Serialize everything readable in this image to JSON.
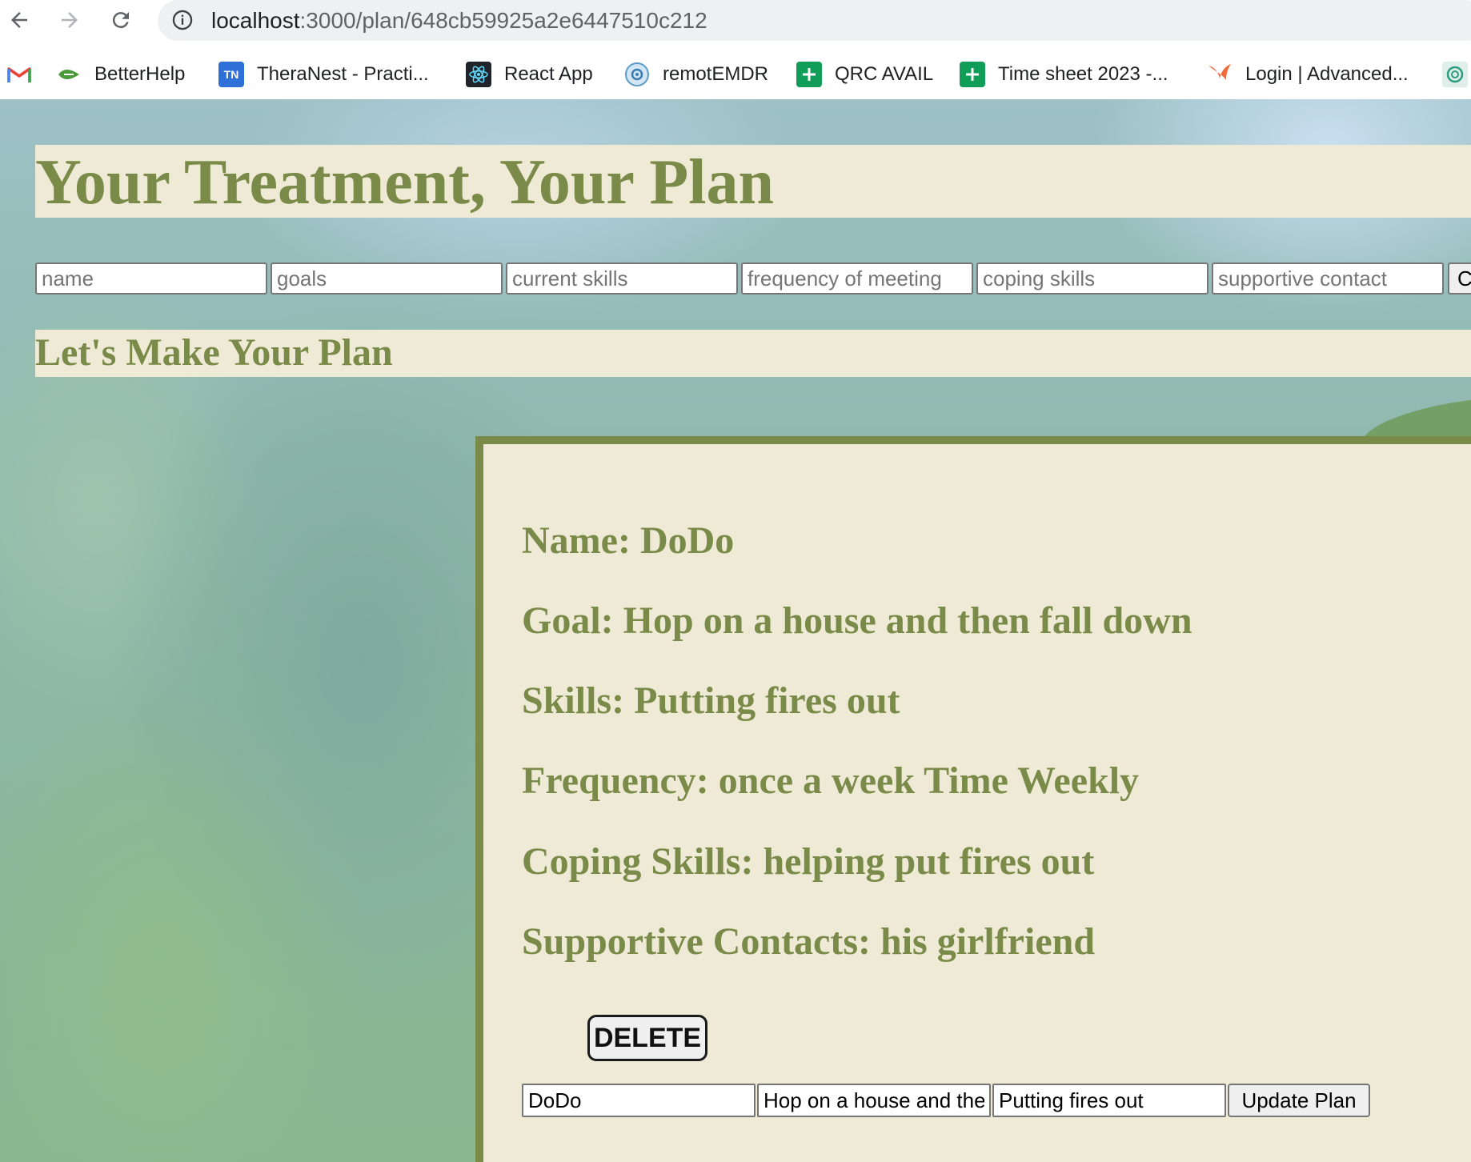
{
  "browser": {
    "url_host": "localhost",
    "url_rest": ":3000/plan/648cb59925a2e6447510c212",
    "bookmarks": [
      {
        "label": "",
        "icon": "gmail-icon"
      },
      {
        "label": "BetterHelp",
        "icon": "betterhelp-icon"
      },
      {
        "label": "TheraNest - Practi...",
        "icon": "theranest-icon",
        "icon_text": "TN"
      },
      {
        "label": "React App",
        "icon": "react-icon"
      },
      {
        "label": "remotEMDR",
        "icon": "remotemdr-icon"
      },
      {
        "label": "QRC AVAIL",
        "icon": "sheets-icon"
      },
      {
        "label": "Time sheet 2023 -...",
        "icon": "sheets-icon"
      },
      {
        "label": "Login | Advanced...",
        "icon": "bird-icon"
      },
      {
        "label": "",
        "icon": "chatgpt-icon"
      }
    ]
  },
  "page": {
    "title": "Your Treatment, Your Plan",
    "subtitle": "Let's Make Your Plan",
    "create_form": {
      "placeholders": [
        "name",
        "goals",
        "current skills",
        "frequency of meeting",
        "coping skills",
        "supportive contact"
      ],
      "submit_label_visible": "C"
    }
  },
  "plan": {
    "name": "Name: DoDo",
    "goal": "Goal: Hop on a house and then fall down",
    "skills": "Skills: Putting fires out",
    "frequency": "Frequency: once a week Time Weekly",
    "coping": "Coping Skills: helping put fires out",
    "contacts": "Supportive Contacts: his girlfriend",
    "delete_label": "DELETE",
    "edit": {
      "name_value": "DoDo",
      "goal_value": "Hop on a house and then fall down",
      "skills_value": "Putting fires out",
      "update_label": "Update Plan"
    }
  },
  "colors": {
    "accent_olive": "#7a8a48",
    "panel_beige": "#eeead6"
  }
}
